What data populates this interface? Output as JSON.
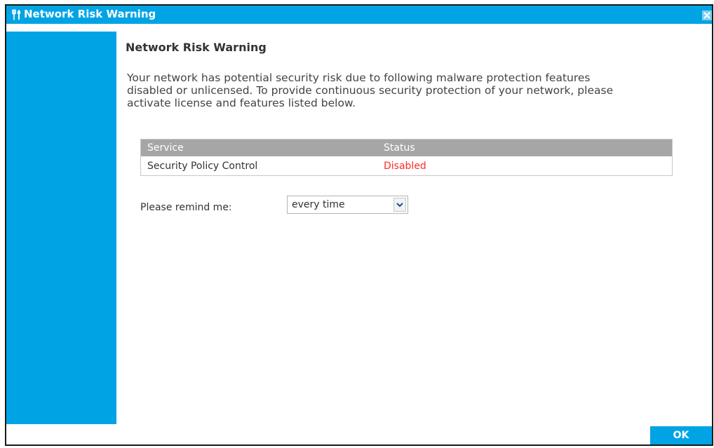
{
  "window": {
    "title": "Network Risk Warning",
    "title_icon": "tools-icon",
    "close_icon": "close-icon"
  },
  "content": {
    "heading": "Network Risk Warning",
    "message_lines": [
      "Your network has potential security risk due to following malware protection features",
      "disabled or unlicensed. To provide continuous security protection of your network, please",
      "activate license and features listed below."
    ]
  },
  "table": {
    "headers": [
      "Service",
      "Status"
    ],
    "rows": [
      {
        "service": "Security Policy Control",
        "status": "Disabled"
      }
    ]
  },
  "remind": {
    "label": "Please remind me:",
    "selected": "every time"
  },
  "buttons": {
    "ok": "OK"
  },
  "colors": {
    "accent": "#00a4e4",
    "table_header": "#a6a6a6",
    "status_disabled": "#ff2a2a"
  }
}
